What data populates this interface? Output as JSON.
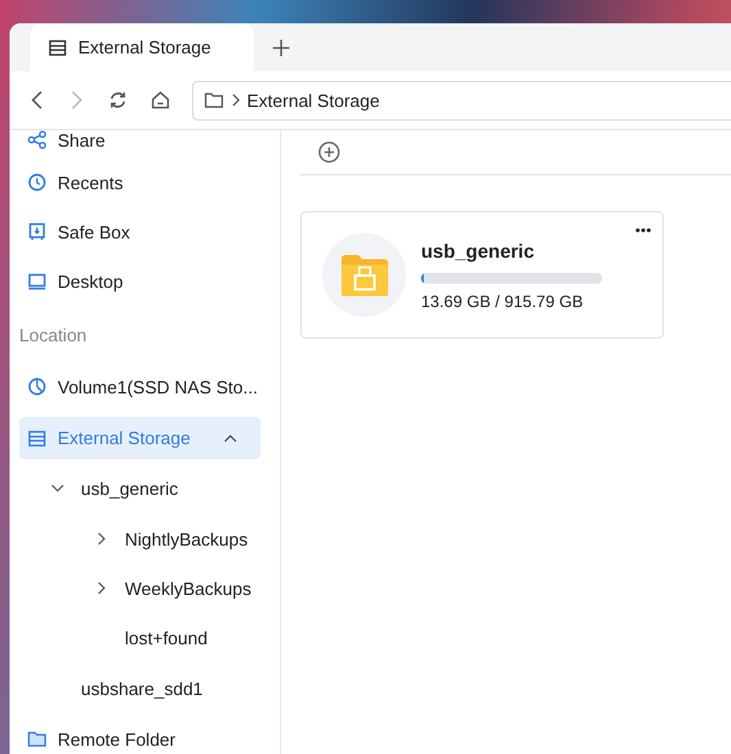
{
  "tabs": [
    {
      "label": "External Storage",
      "selected": true
    }
  ],
  "toolbar": {
    "back_disabled": false,
    "forward_disabled": true,
    "breadcrumb": [
      "External Storage"
    ]
  },
  "sidebar": {
    "items": [
      {
        "kind": "link",
        "label": "Share",
        "selected": false
      },
      {
        "kind": "link",
        "label": "Recents",
        "selected": false
      },
      {
        "kind": "link",
        "label": "Safe Box",
        "selected": false
      },
      {
        "kind": "link",
        "label": "Desktop",
        "selected": false
      },
      {
        "kind": "section",
        "label": "Location"
      },
      {
        "kind": "link",
        "label": "Volume1(SSD NAS Sto...",
        "selected": false
      },
      {
        "kind": "link",
        "label": "External Storage",
        "selected": true,
        "expanded": true,
        "children": [
          {
            "label": "usb_generic",
            "selected": false,
            "expanded": true,
            "children": [
              {
                "label": "NightlyBackups",
                "selected": false,
                "expanded": false
              },
              {
                "label": "WeeklyBackups",
                "selected": false,
                "expanded": false
              },
              {
                "label": "lost+found",
                "selected": false
              }
            ]
          },
          {
            "label": "usbshare_sdd1",
            "selected": false
          }
        ]
      },
      {
        "kind": "link",
        "label": "Remote Folder",
        "selected": false
      }
    ]
  },
  "drives": [
    {
      "name": "usb_generic",
      "level": 0.015,
      "usage": "13.69 GB / 915.79 GB"
    }
  ]
}
